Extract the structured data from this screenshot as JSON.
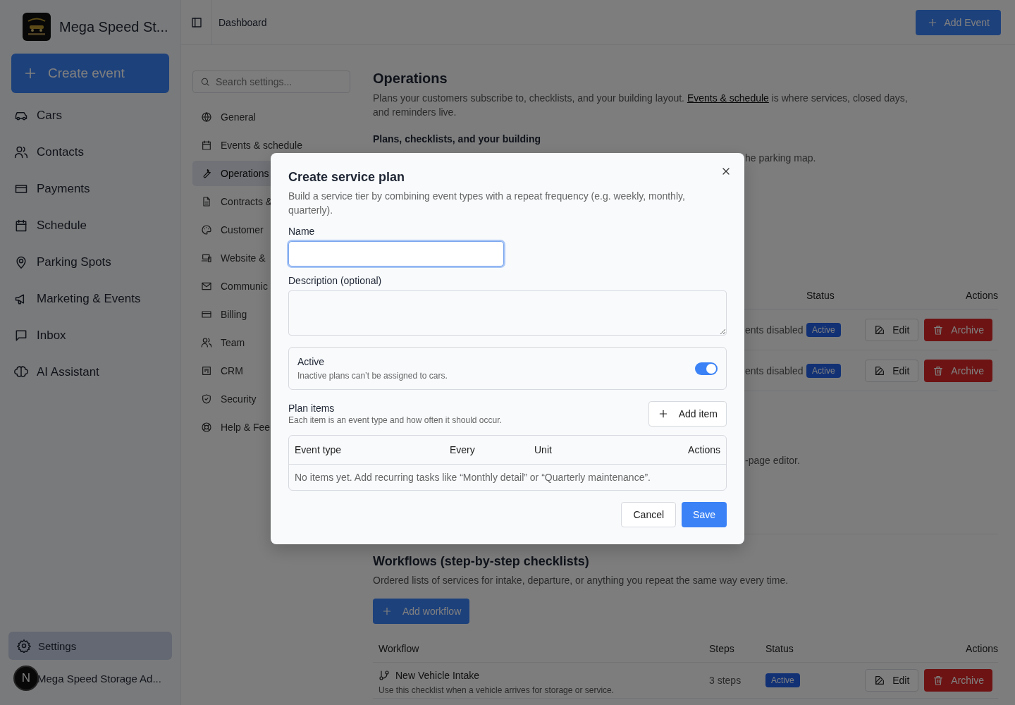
{
  "sidebar": {
    "brand": "Mega Speed St...",
    "create_button": "Create event",
    "items": [
      {
        "label": "Cars"
      },
      {
        "label": "Contacts"
      },
      {
        "label": "Payments"
      },
      {
        "label": "Schedule"
      },
      {
        "label": "Parking Spots"
      },
      {
        "label": "Marketing & Events"
      },
      {
        "label": "Inbox"
      },
      {
        "label": "AI Assistant"
      }
    ],
    "footer_item": {
      "label": "Settings",
      "selected": true
    },
    "user": {
      "initial": "N",
      "name": "Mega Speed Storage Ad..."
    }
  },
  "header": {
    "breadcrumb": "Dashboard",
    "add_button": "Add Event"
  },
  "settings_nav": {
    "search_placeholder": "Search settings...",
    "items": [
      {
        "label": "General",
        "selected": false
      },
      {
        "label": "Events & schedule",
        "selected": false
      },
      {
        "label": "Operations",
        "selected": true
      },
      {
        "label": "Contracts &",
        "selected": false
      },
      {
        "label": "Customer",
        "selected": false
      },
      {
        "label": "Website &",
        "selected": false
      },
      {
        "label": "Communic",
        "selected": false
      },
      {
        "label": "Billing",
        "selected": false
      },
      {
        "label": "Team",
        "selected": false
      },
      {
        "label": "CRM",
        "selected": false
      },
      {
        "label": "Security",
        "selected": false
      },
      {
        "label": "Help & Fee",
        "selected": false
      }
    ]
  },
  "content": {
    "title": "Operations",
    "description_before": "Plans your customers subscribe to, checklists, and your building layout.",
    "description_link": "Events & schedule",
    "description_after": "is where services, closed days, and reminders live.",
    "subheading": "Plans, checklists, and your building",
    "fragment_1": "he parking map.",
    "plans_table": {
      "columns": [
        "Status",
        "Actions"
      ],
      "rows": [
        {
          "column_1": "ents disabled",
          "status": "Active",
          "edit": "Edit",
          "archive": "Archive"
        },
        {
          "column_1": "ents disabled",
          "status": "Active",
          "edit": "Edit",
          "archive": "Archive"
        }
      ]
    },
    "fragment_2": "-page editor.",
    "workflows": {
      "title": "Workflows (step-by-step checklists)",
      "description": "Ordered lists of services for intake, departure, or anything you repeat the same way every time.",
      "add_button": "Add workflow",
      "columns": [
        "Workflow",
        "Steps",
        "Status",
        "Actions"
      ],
      "rows": [
        {
          "name": "New Vehicle Intake",
          "description": "Use this checklist when a vehicle arrives for storage or service.",
          "steps": "3 steps",
          "status": "Active",
          "edit": "Edit",
          "archive": "Archive"
        }
      ]
    }
  },
  "dialog": {
    "title": "Create service plan",
    "description": "Build a service tier by combining event types with a repeat frequency (e.g. weekly, monthly, quarterly).",
    "name_label": "Name",
    "description_label": "Description (optional)",
    "active": {
      "label": "Active",
      "hint": "Inactive plans can’t be assigned to cars.",
      "on": true
    },
    "plan_items": {
      "title": "Plan items",
      "hint": "Each item is an event type and how often it should occur.",
      "add_button": "Add item",
      "columns": [
        "Event type",
        "Every",
        "Unit",
        "Actions"
      ],
      "empty_message": "No items yet. Add recurring tasks like “Monthly detail” or “Quarterly maintenance”."
    },
    "cancel_button": "Cancel",
    "save_button": "Save"
  }
}
